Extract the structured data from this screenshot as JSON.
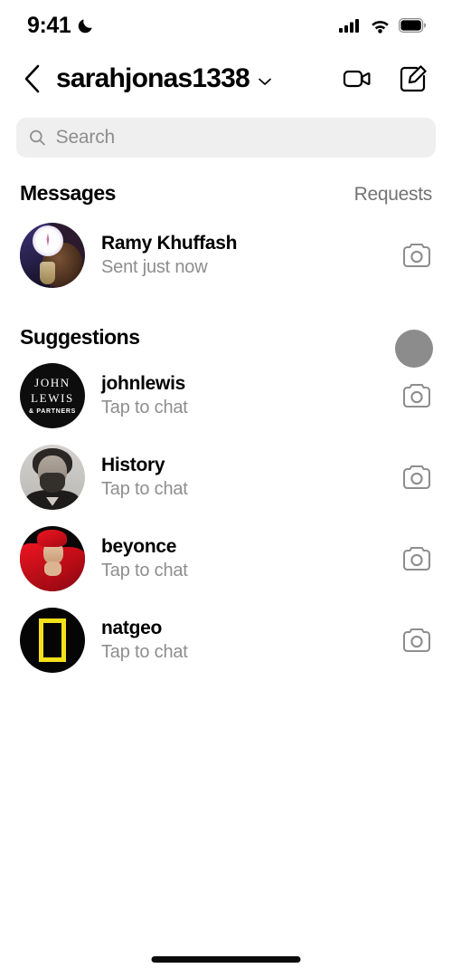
{
  "status_bar": {
    "time": "9:41",
    "dnd_icon": "moon-icon",
    "signal_icon": "cellular-signal-icon",
    "wifi_icon": "wifi-icon",
    "battery_icon": "battery-icon"
  },
  "header": {
    "back_icon": "back-chevron-icon",
    "title": "sarahjonas1338",
    "dropdown_icon": "chevron-down-icon",
    "video_call_icon": "video-camera-icon",
    "compose_icon": "compose-message-icon"
  },
  "search": {
    "placeholder": "Search",
    "value": "",
    "icon": "search-icon"
  },
  "messages_section": {
    "title": "Messages",
    "action_label": "Requests",
    "items": [
      {
        "name": "Ramy Khuffash",
        "status": "Sent just now",
        "avatar_type": "photo-ramy",
        "camera_icon": "camera-icon"
      }
    ]
  },
  "suggestions_section": {
    "title": "Suggestions",
    "items": [
      {
        "name": "johnlewis",
        "status": "Tap to chat",
        "avatar_type": "logo-johnlewis",
        "avatar_text_line1": "JOHN",
        "avatar_text_line2": "LEWIS",
        "avatar_text_line3": "& PARTNERS",
        "camera_icon": "camera-icon"
      },
      {
        "name": "History",
        "status": "Tap to chat",
        "avatar_type": "photo-history",
        "camera_icon": "camera-icon"
      },
      {
        "name": "beyonce",
        "status": "Tap to chat",
        "avatar_type": "photo-beyonce",
        "camera_icon": "camera-icon"
      },
      {
        "name": "natgeo",
        "status": "Tap to chat",
        "avatar_type": "logo-natgeo",
        "camera_icon": "camera-icon"
      }
    ]
  },
  "cursor": {
    "visible": true,
    "color": "#8c8c8c"
  },
  "home_indicator": {
    "visible": true
  },
  "colors": {
    "background": "#ffffff",
    "text_primary": "#000000",
    "text_secondary": "#8e8e8e",
    "text_muted": "#737373",
    "search_bg": "#efefef",
    "natgeo_yellow": "#f5e11b",
    "beyonce_red": "#e8111e"
  }
}
